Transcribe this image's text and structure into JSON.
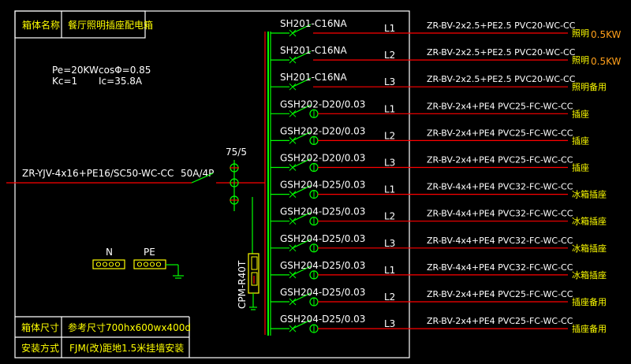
{
  "title_block": {
    "name_label": "箱体名称",
    "name_value": "餐厅照明插座配电箱",
    "size_label": "箱体尺寸",
    "size_value": "参考尺寸700hx600wx400d",
    "install_label": "安装方式",
    "install_value": "FJM(改)距地1.5米挂墙安装"
  },
  "calc": {
    "pe": "Pe=20KW",
    "cos": "cosΦ=0.85",
    "kc": "Kc=1",
    "ic": "Ic=35.8A"
  },
  "incoming": {
    "cable": "ZR-YJV-4x16+PE16/SC50-WC-CC",
    "breaker": "50A/4P",
    "ct": "75/5"
  },
  "spd": {
    "label": "CPM-R40T"
  },
  "terminals": {
    "n": "N",
    "pe": "PE"
  },
  "circuits": [
    {
      "breaker": "SH201-C16NA",
      "phase": "L1",
      "cable": "ZR-BV-2x2.5+PE2.5 PVC20-WC-CC",
      "use": "照明",
      "load": "0.5KW",
      "rcd": false
    },
    {
      "breaker": "SH201-C16NA",
      "phase": "L2",
      "cable": "ZR-BV-2x2.5+PE2.5 PVC20-WC-CC",
      "use": "照明",
      "load": "0.5KW",
      "rcd": false
    },
    {
      "breaker": "SH201-C16NA",
      "phase": "L3",
      "cable": "ZR-BV-2x2.5+PE2.5 PVC20-WC-CC",
      "use": "照明备用",
      "load": "",
      "rcd": false
    },
    {
      "breaker": "GSH202-D20/0.03",
      "phase": "L1",
      "cable": "ZR-BV-2x4+PE4 PVC25-FC-WC-CC",
      "use": "插座",
      "load": "",
      "rcd": true
    },
    {
      "breaker": "GSH202-D20/0.03",
      "phase": "L2",
      "cable": "ZR-BV-2x4+PE4 PVC25-FC-WC-CC",
      "use": "插座",
      "load": "",
      "rcd": true
    },
    {
      "breaker": "GSH202-D20/0.03",
      "phase": "L3",
      "cable": "ZR-BV-2x4+PE4 PVC25-FC-WC-CC",
      "use": "插座",
      "load": "",
      "rcd": true
    },
    {
      "breaker": "GSH204-D25/0.03",
      "phase": "L1",
      "cable": "ZR-BV-4x4+PE4 PVC32-FC-WC-CC",
      "use": "冰箱插座",
      "load": "",
      "rcd": true
    },
    {
      "breaker": "GSH204-D25/0.03",
      "phase": "L2",
      "cable": "ZR-BV-4x4+PE4 PVC32-FC-WC-CC",
      "use": "冰箱插座",
      "load": "",
      "rcd": true
    },
    {
      "breaker": "GSH204-D25/0.03",
      "phase": "L3",
      "cable": "ZR-BV-4x4+PE4 PVC32-FC-WC-CC",
      "use": "冰箱插座",
      "load": "",
      "rcd": true
    },
    {
      "breaker": "GSH204-D25/0.03",
      "phase": "L1",
      "cable": "ZR-BV-4x4+PE4 PVC32-FC-WC-CC",
      "use": "冰箱插座",
      "load": "",
      "rcd": true
    },
    {
      "breaker": "GSH204-D25/0.03",
      "phase": "L2",
      "cable": "ZR-BV-2x4+PE4 PVC25-FC-WC-CC",
      "use": "插座备用",
      "load": "",
      "rcd": true
    },
    {
      "breaker": "GSH204-D25/0.03",
      "phase": "L3",
      "cable": "ZR-BV-2x4+PE4 PVC25-FC-WC-CC",
      "use": "插座备用",
      "load": "",
      "rcd": true
    }
  ],
  "colors": {
    "background": "#000000",
    "frame": "#ffffff",
    "bus": "#00ff00",
    "wire": "#ff0000",
    "label_yellow": "#ffff00",
    "label_orange": "#ff9f1a"
  }
}
